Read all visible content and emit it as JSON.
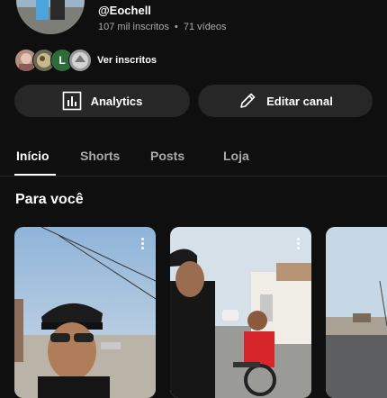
{
  "channel": {
    "handle": "@Eochell",
    "subscribers": "107 mil inscritos",
    "separator": "•",
    "videos": "71 vídeos"
  },
  "subscribers_row": {
    "avatar_letter": "L",
    "label": "Ver inscritos"
  },
  "actions": {
    "analytics_label": "Analytics",
    "analytics_icon": "bar-chart-icon",
    "edit_label": "Editar canal",
    "edit_icon": "pencil-icon"
  },
  "tabs": [
    {
      "label": "Início",
      "active": true
    },
    {
      "label": "Shorts",
      "active": false
    },
    {
      "label": "Posts",
      "active": false
    },
    {
      "label": "Loja",
      "active": false
    }
  ],
  "section": {
    "title": "Para você"
  },
  "colors": {
    "background": "#0f0f0f",
    "button_bg": "#272727",
    "muted_text": "#aaaaaa"
  }
}
